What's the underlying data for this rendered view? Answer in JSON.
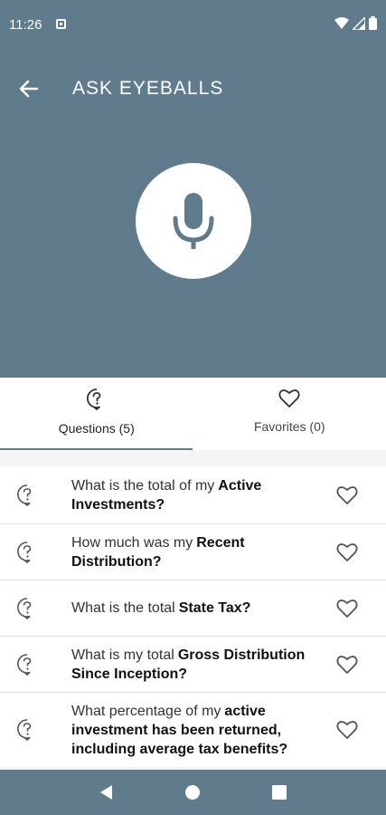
{
  "status_bar": {
    "time": "11:26"
  },
  "app_bar": {
    "title": "ASK EYEBALLS"
  },
  "tabs": [
    {
      "label": "Questions (5)",
      "icon": "question-bubble-icon",
      "active": true
    },
    {
      "label": "Favorites (0)",
      "icon": "heart-icon",
      "active": false
    }
  ],
  "questions": [
    {
      "plain": "What is the total of my",
      "bold": "Active Investments?"
    },
    {
      "plain": "How much was my",
      "bold": "Recent Distribution?"
    },
    {
      "plain": "What is the total",
      "bold": "State Tax?"
    },
    {
      "plain": "What is my total",
      "bold": "Gross Distribution Since Inception?"
    },
    {
      "plain": "What percentage of my",
      "bold": "active investment has been returned, including average tax benefits?"
    }
  ],
  "colors": {
    "primary": "#607b8b",
    "surface": "#ffffff"
  }
}
